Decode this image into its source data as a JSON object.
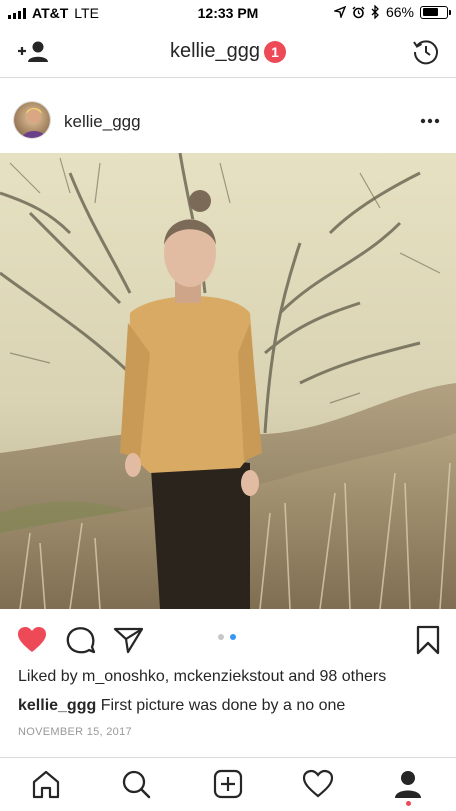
{
  "status_bar": {
    "carrier": "AT&T",
    "network": "LTE",
    "time": "12:33 PM",
    "battery_percent": "66%",
    "battery_level": 0.66
  },
  "header": {
    "username": "kellie_ggg",
    "notification_count": "1",
    "left_icon": "add-user-icon",
    "right_icon": "history-icon"
  },
  "post": {
    "username": "kellie_ggg",
    "likes_text": "Liked by m_onoshko, mckenziekstout and 98 others",
    "caption_user": "kellie_ggg",
    "caption_text": "First picture was done by a no one",
    "date": "NOVEMBER 15, 2017",
    "carousel_pages": 2,
    "carousel_active": 2
  },
  "colors": {
    "like_red": "#ed4956",
    "carousel_active": "#3897f0",
    "carousel_inactive": "#c7c7c7",
    "text": "#262626",
    "muted": "#999999"
  },
  "tab_bar": {
    "items": [
      "home-icon",
      "search-icon",
      "new-post-icon",
      "activity-icon",
      "profile-icon"
    ],
    "active": "profile-icon"
  }
}
